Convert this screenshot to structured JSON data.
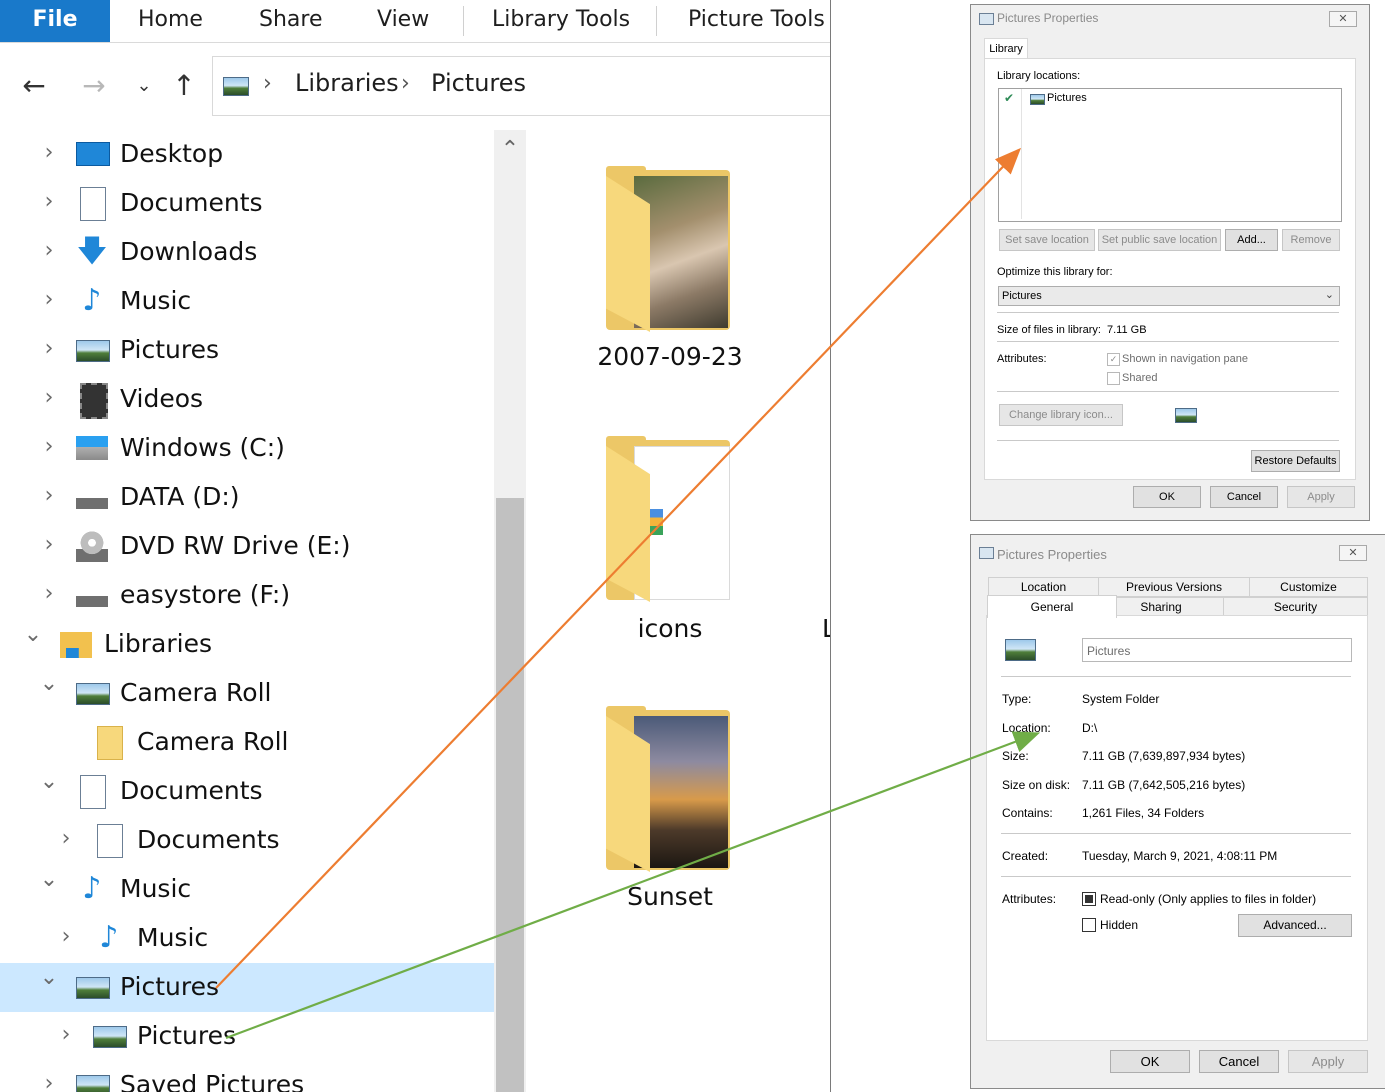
{
  "colors": {
    "file_tab": "#1979ca",
    "selection": "#cce8ff",
    "arrow_orange": "#ed7d31",
    "arrow_green": "#70ad47"
  },
  "explorer": {
    "ribbon_tabs": [
      "File",
      "Home",
      "Share",
      "View",
      "Library Tools",
      "Picture Tools"
    ],
    "breadcrumb": [
      "Libraries",
      "Pictures"
    ],
    "nav_icons": {
      "back": "back-arrow-icon",
      "forward": "forward-arrow-icon",
      "recent": "chevron-down-icon",
      "up": "up-arrow-icon"
    },
    "tree": [
      {
        "label": "Desktop",
        "icon": "desktop-icon",
        "expander": "collapsed",
        "level": 1
      },
      {
        "label": "Documents",
        "icon": "documents-icon",
        "expander": "collapsed",
        "level": 1
      },
      {
        "label": "Downloads",
        "icon": "downloads-icon",
        "expander": "collapsed",
        "level": 1
      },
      {
        "label": "Music",
        "icon": "music-icon",
        "expander": "collapsed",
        "level": 1
      },
      {
        "label": "Pictures",
        "icon": "pictures-icon",
        "expander": "collapsed",
        "level": 1
      },
      {
        "label": "Videos",
        "icon": "videos-icon",
        "expander": "collapsed",
        "level": 1
      },
      {
        "label": "Windows (C:)",
        "icon": "windows-drive-icon",
        "expander": "collapsed",
        "level": 1
      },
      {
        "label": "DATA (D:)",
        "icon": "drive-icon",
        "expander": "collapsed",
        "level": 1
      },
      {
        "label": "DVD RW Drive (E:)",
        "icon": "dvd-drive-icon",
        "expander": "collapsed",
        "level": 1
      },
      {
        "label": "easystore (F:)",
        "icon": "drive-icon",
        "expander": "collapsed",
        "level": 1
      },
      {
        "label": "Libraries",
        "icon": "libraries-icon",
        "expander": "expanded",
        "level": 0
      },
      {
        "label": "Camera Roll",
        "icon": "pictures-library-icon",
        "expander": "expanded",
        "level": 1
      },
      {
        "label": "Camera Roll",
        "icon": "folder-icon",
        "expander": "none",
        "level": 2
      },
      {
        "label": "Documents",
        "icon": "documents-icon",
        "expander": "expanded",
        "level": 1
      },
      {
        "label": "Documents",
        "icon": "documents-icon",
        "expander": "collapsed",
        "level": 2
      },
      {
        "label": "Music",
        "icon": "music-icon",
        "expander": "expanded",
        "level": 1
      },
      {
        "label": "Music",
        "icon": "music-icon",
        "expander": "collapsed",
        "level": 2
      },
      {
        "label": "Pictures",
        "icon": "pictures-library-icon",
        "expander": "expanded",
        "level": 1,
        "selected": true
      },
      {
        "label": "Pictures",
        "icon": "pictures-icon",
        "expander": "collapsed",
        "level": 2
      },
      {
        "label": "Saved Pictures",
        "icon": "pictures-library-icon",
        "expander": "collapsed",
        "level": 1
      }
    ],
    "folders": [
      {
        "name": "2007-09-23",
        "thumb": "photo"
      },
      {
        "name": "icons",
        "thumb": "document"
      },
      {
        "name": "Sunset",
        "thumb": "sunset"
      }
    ],
    "cutoff_char": "L"
  },
  "library_dialog": {
    "title": "Pictures Properties",
    "tab": "Library",
    "locations_label": "Library locations:",
    "location_item": "Pictures",
    "buttons": {
      "set_save": "Set save location",
      "set_public": "Set public save location",
      "add": "Add...",
      "remove": "Remove"
    },
    "optimize_label": "Optimize this library for:",
    "optimize_value": "Pictures",
    "size_label": "Size of files in library:",
    "size_value": "7.11 GB",
    "attributes_label": "Attributes:",
    "shown_in_nav": "Shown in navigation pane",
    "shown_checked": true,
    "shared": "Shared",
    "shared_checked": false,
    "change_icon": "Change library icon...",
    "restore": "Restore Defaults",
    "ok": "OK",
    "cancel": "Cancel",
    "apply": "Apply"
  },
  "folder_dialog": {
    "title": "Pictures Properties",
    "tabs_top": [
      "Location",
      "Previous Versions",
      "Customize"
    ],
    "tabs_bottom": [
      "General",
      "Sharing",
      "Security"
    ],
    "active_tab": "General",
    "name": "Pictures",
    "props": [
      {
        "label": "Type:",
        "value": "System Folder"
      },
      {
        "label": "Location:",
        "value": "D:\\"
      },
      {
        "label": "Size:",
        "value": "7.11 GB (7,639,897,934 bytes)"
      },
      {
        "label": "Size on disk:",
        "value": "7.11 GB (7,642,505,216 bytes)"
      },
      {
        "label": "Contains:",
        "value": "1,261 Files, 34 Folders"
      }
    ],
    "created_label": "Created:",
    "created_value": "Tuesday, March 9, 2021, 4:08:11 PM",
    "attributes_label": "Attributes:",
    "readonly": "Read-only (Only applies to files in folder)",
    "readonly_state": "indeterminate",
    "hidden": "Hidden",
    "hidden_checked": false,
    "advanced": "Advanced...",
    "ok": "OK",
    "cancel": "Cancel",
    "apply": "Apply"
  }
}
